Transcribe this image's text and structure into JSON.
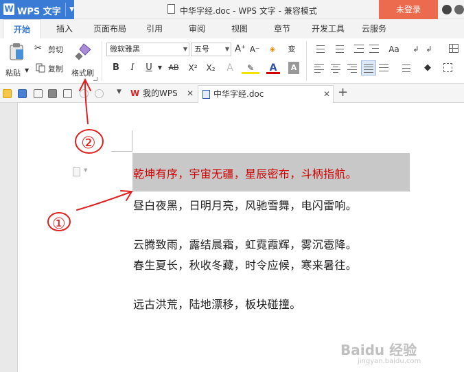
{
  "titlebar": {
    "app_name": "WPS 文字",
    "document_title": "中华字经.doc - WPS 文字 - 兼容模式",
    "login_label": "未登录"
  },
  "menu": {
    "tabs": [
      "开始",
      "插入",
      "页面布局",
      "引用",
      "审阅",
      "视图",
      "章节",
      "开发工具",
      "云服务"
    ]
  },
  "ribbon": {
    "paste_label": "粘贴",
    "cut_label": "剪切",
    "copy_label": "复制",
    "format_painter_label": "格式刷",
    "font_name": "微软雅黑",
    "font_size": "五号",
    "bold": "B",
    "italic": "I",
    "underline": "U",
    "strikethrough": "AB",
    "superscript": "X²",
    "subscript": "X₂",
    "font_color_letter": "A",
    "grow_font": "A⁺",
    "shrink_font": "A⁻",
    "phonetic": "变"
  },
  "tabs": {
    "mywps_label": "我的WPS",
    "doc_label": "中华字经.doc",
    "add_label": "+"
  },
  "document": {
    "lines": [
      "乾坤有序，宇宙无疆，星辰密布，斗柄指航。",
      "昼白夜黑，日明月亮，风驰雪舞，电闪雷响。",
      "云腾致雨，露结晨霜，虹霓霞辉，雾沉雹降。",
      "春生夏长，秋收冬藏，时令应候，寒来暑往。",
      "远古洪荒，陆地漂移，板块碰撞。"
    ]
  },
  "annotations": {
    "marker_1": "①",
    "marker_2": "②"
  },
  "watermark": {
    "brand": "Baidu 经验",
    "url": "jingyan.baidu.com"
  },
  "colors": {
    "accent": "#3a7bd5",
    "login": "#ec6b4e",
    "selected_text": "#d00000",
    "selection_bg": "#c8c8c8",
    "annotation": "#e02020"
  }
}
